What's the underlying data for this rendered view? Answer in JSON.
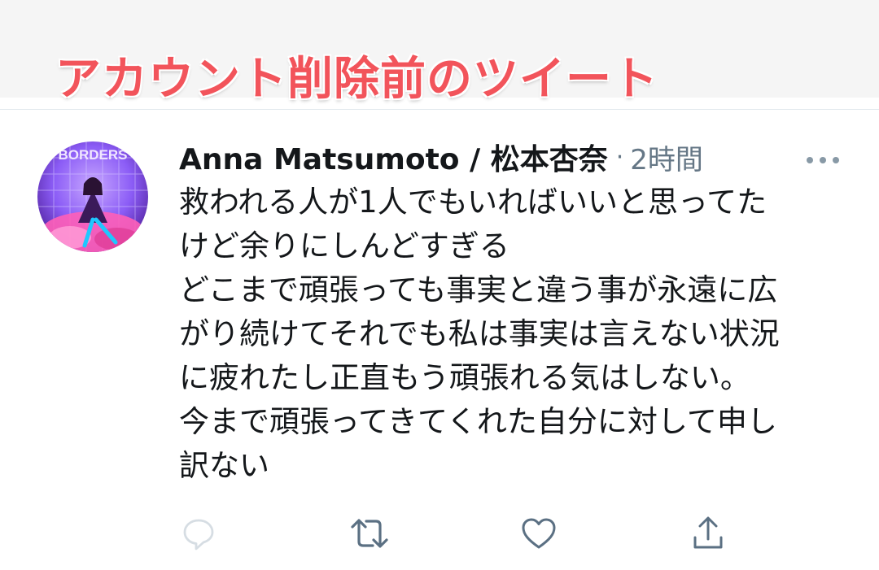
{
  "banner": {
    "title": "アカウント削除前のツイート",
    "color": "#f2545b"
  },
  "tweet": {
    "author_name": "Anna Matsumoto / 松本杏奈",
    "separator": "·",
    "timestamp": "2時間",
    "avatar_text": "BORDERS",
    "lines": [
      "救われる人が1人でもいればいいと思ってた",
      "けど余りにしんどすぎる",
      "どこまで頑張っても事実と違う事が永遠に広",
      "がり続けてそれでも私は事実は言えない状況",
      "に疲れたし正直もう頑張れる気はしない。",
      "今まで頑張ってきてくれた自分に対して申し",
      "訳ない"
    ],
    "icons": {
      "more": "more-horizontal-icon",
      "reply": "reply-icon",
      "retweet": "retweet-icon",
      "like": "heart-icon",
      "share": "share-icon"
    }
  },
  "colors": {
    "text": "#14171a",
    "secondary": "#657786",
    "icon": "#5b7083",
    "divider": "#e1e8ed"
  }
}
